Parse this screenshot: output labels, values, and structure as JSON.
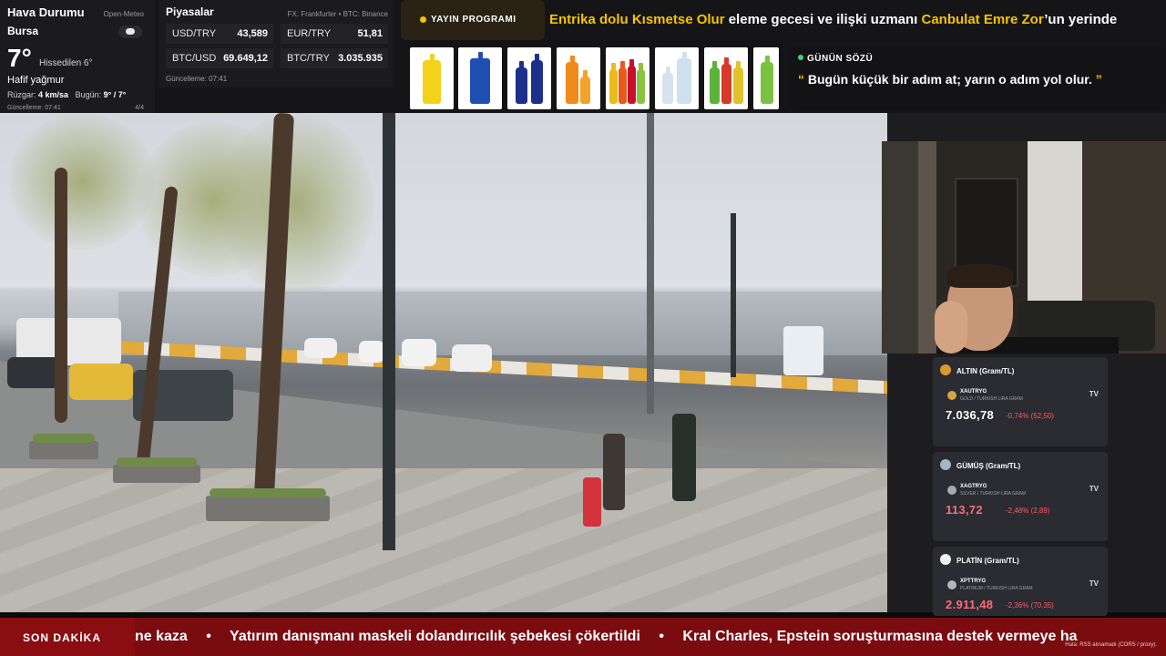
{
  "weather": {
    "title": "Hava Durumu",
    "source": "Open-Meteo",
    "city": "Bursa",
    "temp": "7°",
    "feels": "Hissedilen 6°",
    "description": "Hafif yağmur",
    "wind_label": "Rüzgar:",
    "wind_value": "4 km/sa",
    "today_label": "Bugün:",
    "today_value": "9° / 7°",
    "updated": "Güncelleme: 07:41",
    "page": "4/4"
  },
  "markets": {
    "title": "Piyasalar",
    "source": "FX: Frankfurter • BTC: Binance",
    "items": [
      {
        "label": "USD/TRY",
        "value": "43,589"
      },
      {
        "label": "EUR/TRY",
        "value": "51,81"
      },
      {
        "label": "BTC/USD",
        "value": "69.649,12"
      },
      {
        "label": "BTC/TRY",
        "value": "3.035.935"
      }
    ],
    "updated": "Güncelleme: 07:41"
  },
  "program": {
    "label": "YAYIN PROGRAMI",
    "part1": "Entrika dolu Kısmetse Olur",
    "part2": " eleme gecesi ve ilişki uzmanı ",
    "part3": "Canbulat Emre Zor",
    "part4": "’un yerinde"
  },
  "quote": {
    "title": "GÜNÜN SÖZÜ",
    "open": "“",
    "text": "Bugün küçük bir adım at; yarın o adım yol olur.",
    "close": "”"
  },
  "metals": [
    {
      "title": "ALTIN (Gram/TL)",
      "symbol": "XAUTRYG",
      "name": "GOLD / TURKISH LIRA GRAM",
      "price": "7.036,78",
      "change": "-0,74% (52,50)",
      "medal": "#d99a2b"
    },
    {
      "title": "GÜMÜŞ (Gram/TL)",
      "symbol": "XAGTRYG",
      "name": "SILVER / TURKISH LIRA GRAM",
      "price": "113,72",
      "change": "-2,48% (2,89)",
      "medal": "#9fb7c9"
    },
    {
      "title": "PLATİN (Gram/TL)",
      "symbol": "XPTTRYG",
      "name": "PLATINUM / TURKISH LIRA GRAM",
      "price": "2.911,48",
      "change": "-2,36% (70,35)",
      "medal": "#f0f0f0"
    }
  ],
  "tv_label": "TV",
  "ticker": {
    "label": "SON DAKİKA",
    "items": [
      "ne kaza",
      "Yatırım danışmanı maskeli dolandırıcılık şebekesi çökertildi",
      "Kral Charles, Epstein soruşturmasına destek vermeye ha"
    ],
    "separator": "•",
    "rss_note": "Hata: RSS alınamadı (CORS / proxy)."
  },
  "colors": {
    "accent": "#f5c400",
    "ticker_bg": "#7a0c10",
    "negative": "#ff5a64"
  }
}
